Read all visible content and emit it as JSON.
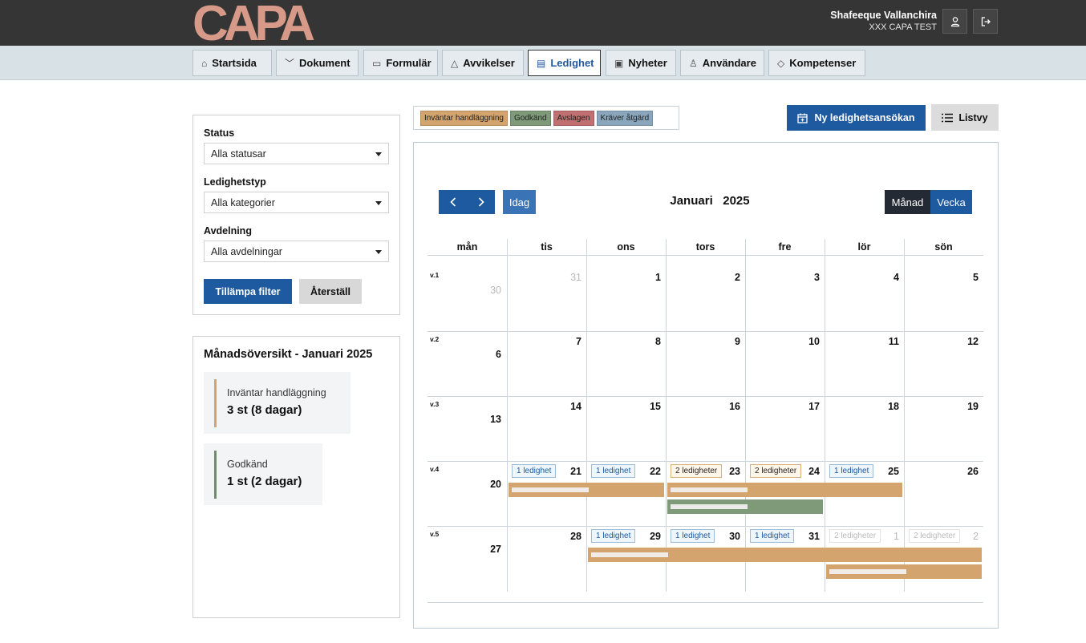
{
  "header": {
    "logo_text": "CAPA",
    "user_name": "Shafeeque Vallanchira",
    "user_org": "XXX CAPA TEST",
    "profile_icon": "user-icon",
    "logout_icon": "logout-icon"
  },
  "nav": {
    "items": [
      {
        "label": "Startsida",
        "icon": "home-icon"
      },
      {
        "label": "Dokument",
        "icon": "chevron-down-icon"
      },
      {
        "label": "Formulär",
        "icon": "clipboard-icon"
      },
      {
        "label": "Avvikelser",
        "icon": "warning-icon"
      },
      {
        "label": "Ledighet",
        "icon": "calendar-icon"
      },
      {
        "label": "Nyheter",
        "icon": "news-icon"
      },
      {
        "label": "Användare",
        "icon": "user-icon"
      },
      {
        "label": "Kompetenser",
        "icon": "badge-icon"
      }
    ],
    "active": "Ledighet"
  },
  "filters": {
    "status_label": "Status",
    "status_value": "Alla statusar",
    "type_label": "Ledighetstyp",
    "type_value": "Alla kategorier",
    "dept_label": "Avdelning",
    "dept_value": "Alla avdelningar",
    "apply_label": "Tillämpa filter",
    "reset_label": "Återställ"
  },
  "summary": {
    "title": "Månadsöversikt - Januari 2025",
    "cards": [
      {
        "label": "Inväntar handläggning",
        "value": "3 st (8 dagar)",
        "color": "#d3a46d"
      },
      {
        "label": "Godkänd",
        "value": "1 st (2 dagar)",
        "color": "#6e8c6b"
      }
    ]
  },
  "legend": [
    {
      "label": "Inväntar handläggning",
      "color": "#d3a46d"
    },
    {
      "label": "Godkänd",
      "color": "#7e9a78"
    },
    {
      "label": "Avslagen",
      "color": "#c07070"
    },
    {
      "label": "Kräver åtgärd",
      "color": "#8aa6bd"
    }
  ],
  "toolbar": {
    "new_label": "Ny ledighetsansökan",
    "list_label": "Listvy"
  },
  "calendar": {
    "prev_icon": "chevron-left-icon",
    "next_icon": "chevron-right-icon",
    "today_label": "Idag",
    "month": "Januari",
    "year": "2025",
    "view_month": "Månad",
    "view_week": "Vecka",
    "weekdays": [
      "mån",
      "tis",
      "ons",
      "tors",
      "fre",
      "lör",
      "sön"
    ],
    "weeks": [
      {
        "week": "v.1",
        "days": [
          "30",
          "31",
          "1",
          "2",
          "3",
          "4",
          "5"
        ],
        "muted": [
          true,
          true,
          false,
          false,
          false,
          false,
          false
        ]
      },
      {
        "week": "v.2",
        "days": [
          "6",
          "7",
          "8",
          "9",
          "10",
          "11",
          "12"
        ],
        "muted": [
          false,
          false,
          false,
          false,
          false,
          false,
          false
        ]
      },
      {
        "week": "v.3",
        "days": [
          "13",
          "14",
          "15",
          "16",
          "17",
          "18",
          "19"
        ],
        "muted": [
          false,
          false,
          false,
          false,
          false,
          false,
          false
        ]
      },
      {
        "week": "v.4",
        "days": [
          "20",
          "21",
          "22",
          "23",
          "24",
          "25",
          "26"
        ],
        "muted": [
          false,
          false,
          false,
          false,
          false,
          false,
          false
        ]
      },
      {
        "week": "v.5",
        "days": [
          "27",
          "28",
          "29",
          "30",
          "31",
          "1",
          "2"
        ],
        "muted": [
          false,
          false,
          false,
          false,
          false,
          true,
          true
        ]
      }
    ],
    "badges": {
      "w4_tis": "1 ledighet",
      "w4_ons": "1 ledighet",
      "w4_tors": "2 ledigheter",
      "w4_fre": "2 ledigheter",
      "w4_lor": "1 ledighet",
      "w5_ons": "1 ledighet",
      "w5_tors": "1 ledighet",
      "w5_fre": "1 ledighet",
      "w5_lor": "2 ledigheter",
      "w5_son": "2 ledigheter"
    }
  }
}
